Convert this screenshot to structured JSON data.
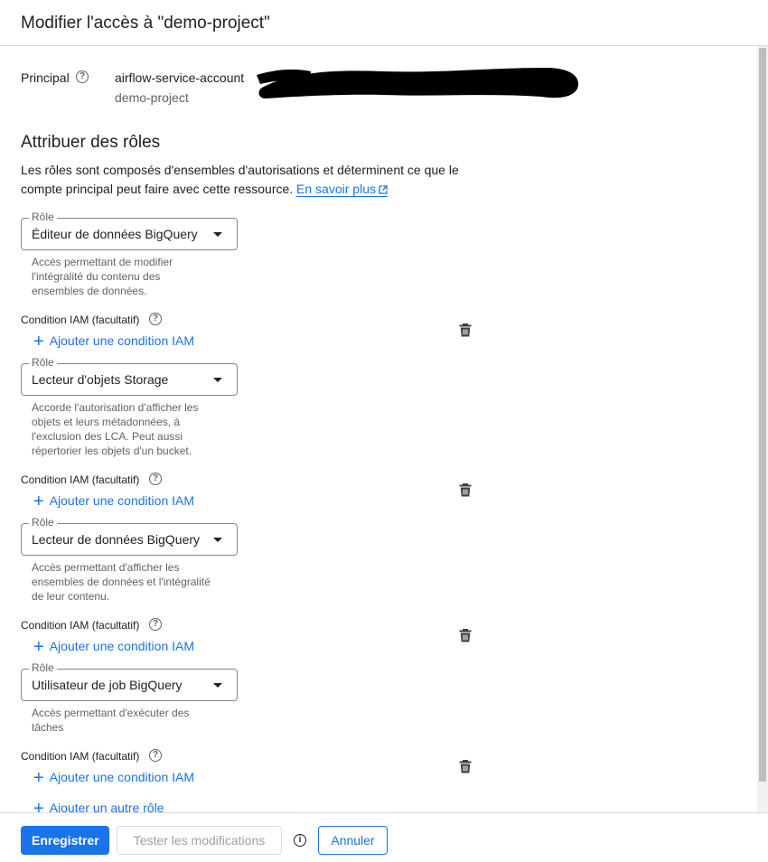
{
  "dialog": {
    "title": "Modifier l'accès à \"demo-project\""
  },
  "principal": {
    "label": "Principal",
    "email": "airflow-service-account",
    "project": "demo-project"
  },
  "roles_section": {
    "title": "Attribuer des rôles",
    "description": "Les rôles sont composés d'ensembles d'autorisations et déterminent ce que le compte principal peut faire avec cette ressource.",
    "learn_more": "En savoir plus"
  },
  "roles": [
    {
      "field_label": "Rôle",
      "value": "Éditeur de données BigQuery",
      "description": "Accès permettant de modifier l'intégralité du contenu des ensembles de données.",
      "condition_label": "Condition IAM (facultatif)",
      "add_condition": "Ajouter une condition IAM"
    },
    {
      "field_label": "Rôle",
      "value": "Lecteur d'objets Storage",
      "description": "Accorde l'autorisation d'afficher les objets et leurs métadonnées, à l'exclusion des LCA. Peut aussi répertorier les objets d'un bucket.",
      "condition_label": "Condition IAM (facultatif)",
      "add_condition": "Ajouter une condition IAM"
    },
    {
      "field_label": "Rôle",
      "value": "Lecteur de données BigQuery",
      "description": "Accès permettant d'afficher les ensembles de données et l'intégralité de leur contenu.",
      "condition_label": "Condition IAM (facultatif)",
      "add_condition": "Ajouter une condition IAM"
    },
    {
      "field_label": "Rôle",
      "value": "Utilisateur de job BigQuery",
      "description": "Accès permettant d'exécuter des tâches",
      "condition_label": "Condition IAM (facultatif)",
      "add_condition": "Ajouter une condition IAM"
    }
  ],
  "add_role": "Ajouter un autre rôle",
  "footer": {
    "save": "Enregistrer",
    "test_changes": "Tester les modifications",
    "cancel": "Annuler"
  }
}
